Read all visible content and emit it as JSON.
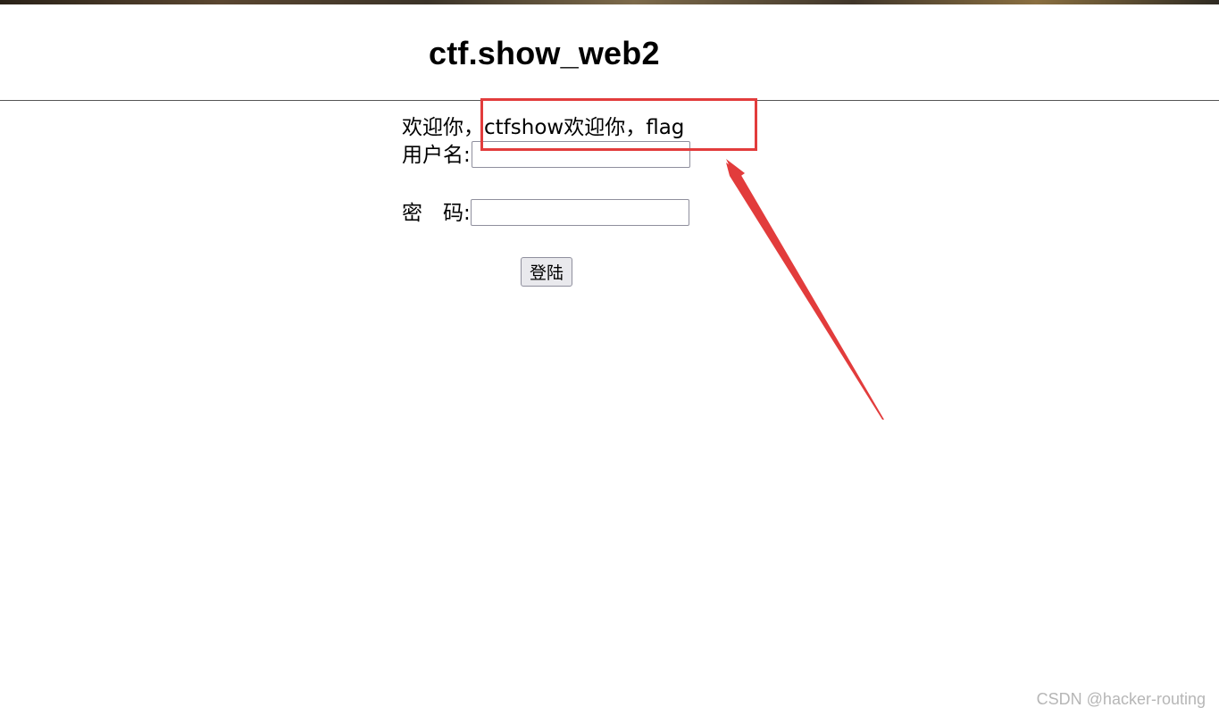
{
  "page": {
    "title": "ctf.show_web2",
    "welcome_text": "欢迎你，ctfshow欢迎你，flag"
  },
  "form": {
    "username_label": "用户名:",
    "username_value": "",
    "password_label": "密　码:",
    "password_value": "",
    "login_button": "登陆"
  },
  "annotation": {
    "color": "#e23c3c"
  },
  "watermark": "CSDN @hacker-routing",
  "colors": {
    "background": "#ffffff",
    "annotation": "#e23c3c"
  }
}
